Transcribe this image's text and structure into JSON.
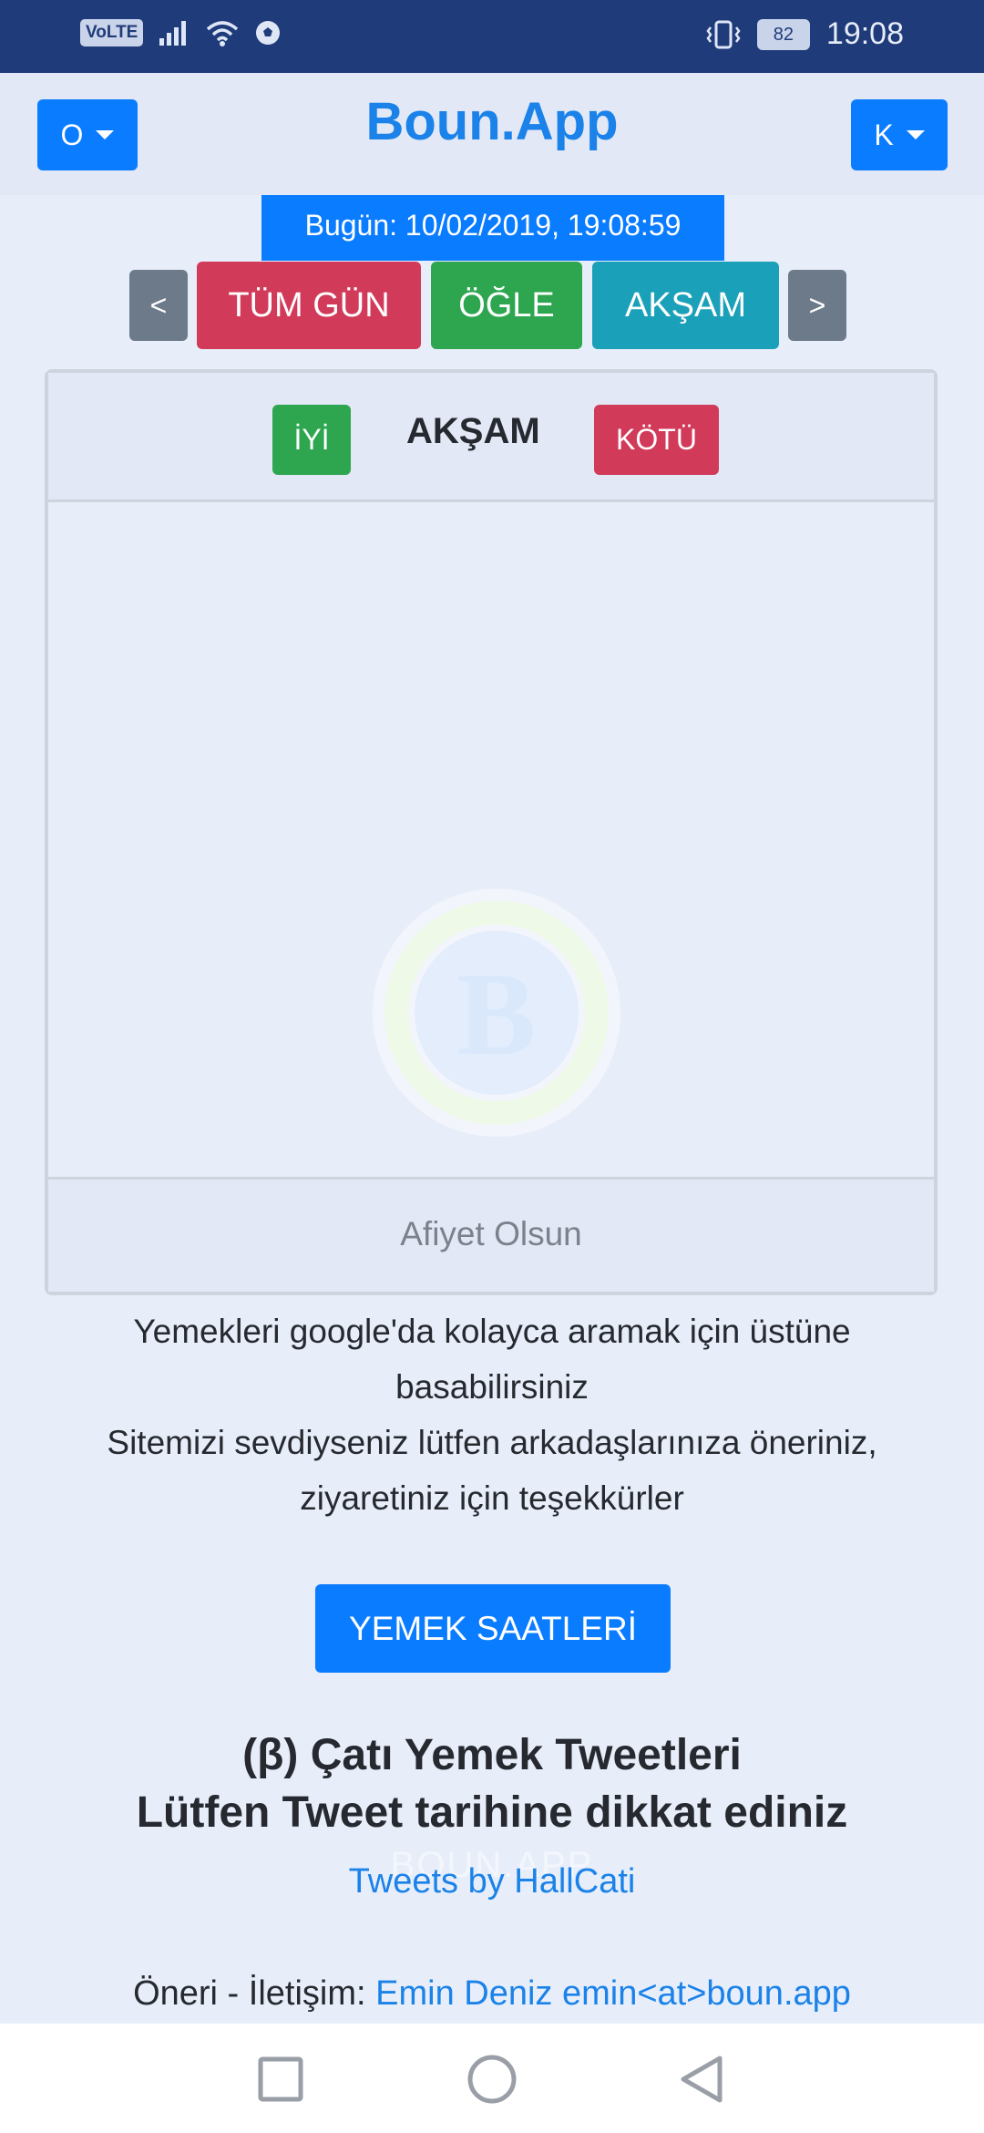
{
  "status_bar": {
    "volte": "VoLTE",
    "battery": "82",
    "time": "19:08"
  },
  "header": {
    "left_dropdown": "O",
    "brand": "Boun.App",
    "right_dropdown": "K"
  },
  "date_badge": "Bugün: 10/02/2019, 19:08:59",
  "meal_nav": {
    "prev": "<",
    "all_day": "TÜM GÜN",
    "lunch": "ÖĞLE",
    "dinner": "AKŞAM",
    "next": ">"
  },
  "card": {
    "good": "İYİ",
    "title": "AKŞAM",
    "bad": "KÖTÜ",
    "logo_letter": "B",
    "footer": "Afiyet Olsun"
  },
  "info_lines": [
    "Yemekleri google'da kolayca aramak için üstüne",
    "basabilirsiniz",
    "Sitemizi sevdiyseniz lütfen arkadaşlarınıza öneriniz,",
    "ziyaretiniz için teşekkürler"
  ],
  "hours_button": "YEMEK SAATLERİ",
  "tweets": {
    "heading_1": "(β) Çatı Yemek Tweetleri",
    "heading_2": "Lütfen Tweet tarihine dikkat ediniz",
    "ghost": "BOUN.APP",
    "link": "Tweets by HallCati"
  },
  "contact": {
    "label": "Öneri - İletişim: ",
    "link": "Emin Deniz emin<at>boun.app"
  },
  "colors": {
    "primary": "#0a7cff",
    "success": "#2ea650",
    "danger": "#d13a59",
    "info": "#1aa0b8",
    "secondary": "#6c7a89",
    "status_bar": "#1f3b7a"
  },
  "icons": {
    "status_left": [
      "volte-icon",
      "signal-icon",
      "wifi-icon",
      "football-icon"
    ],
    "status_right": [
      "vibrate-icon",
      "battery-icon"
    ],
    "system_nav": [
      "recents-icon",
      "home-icon",
      "back-icon"
    ]
  }
}
